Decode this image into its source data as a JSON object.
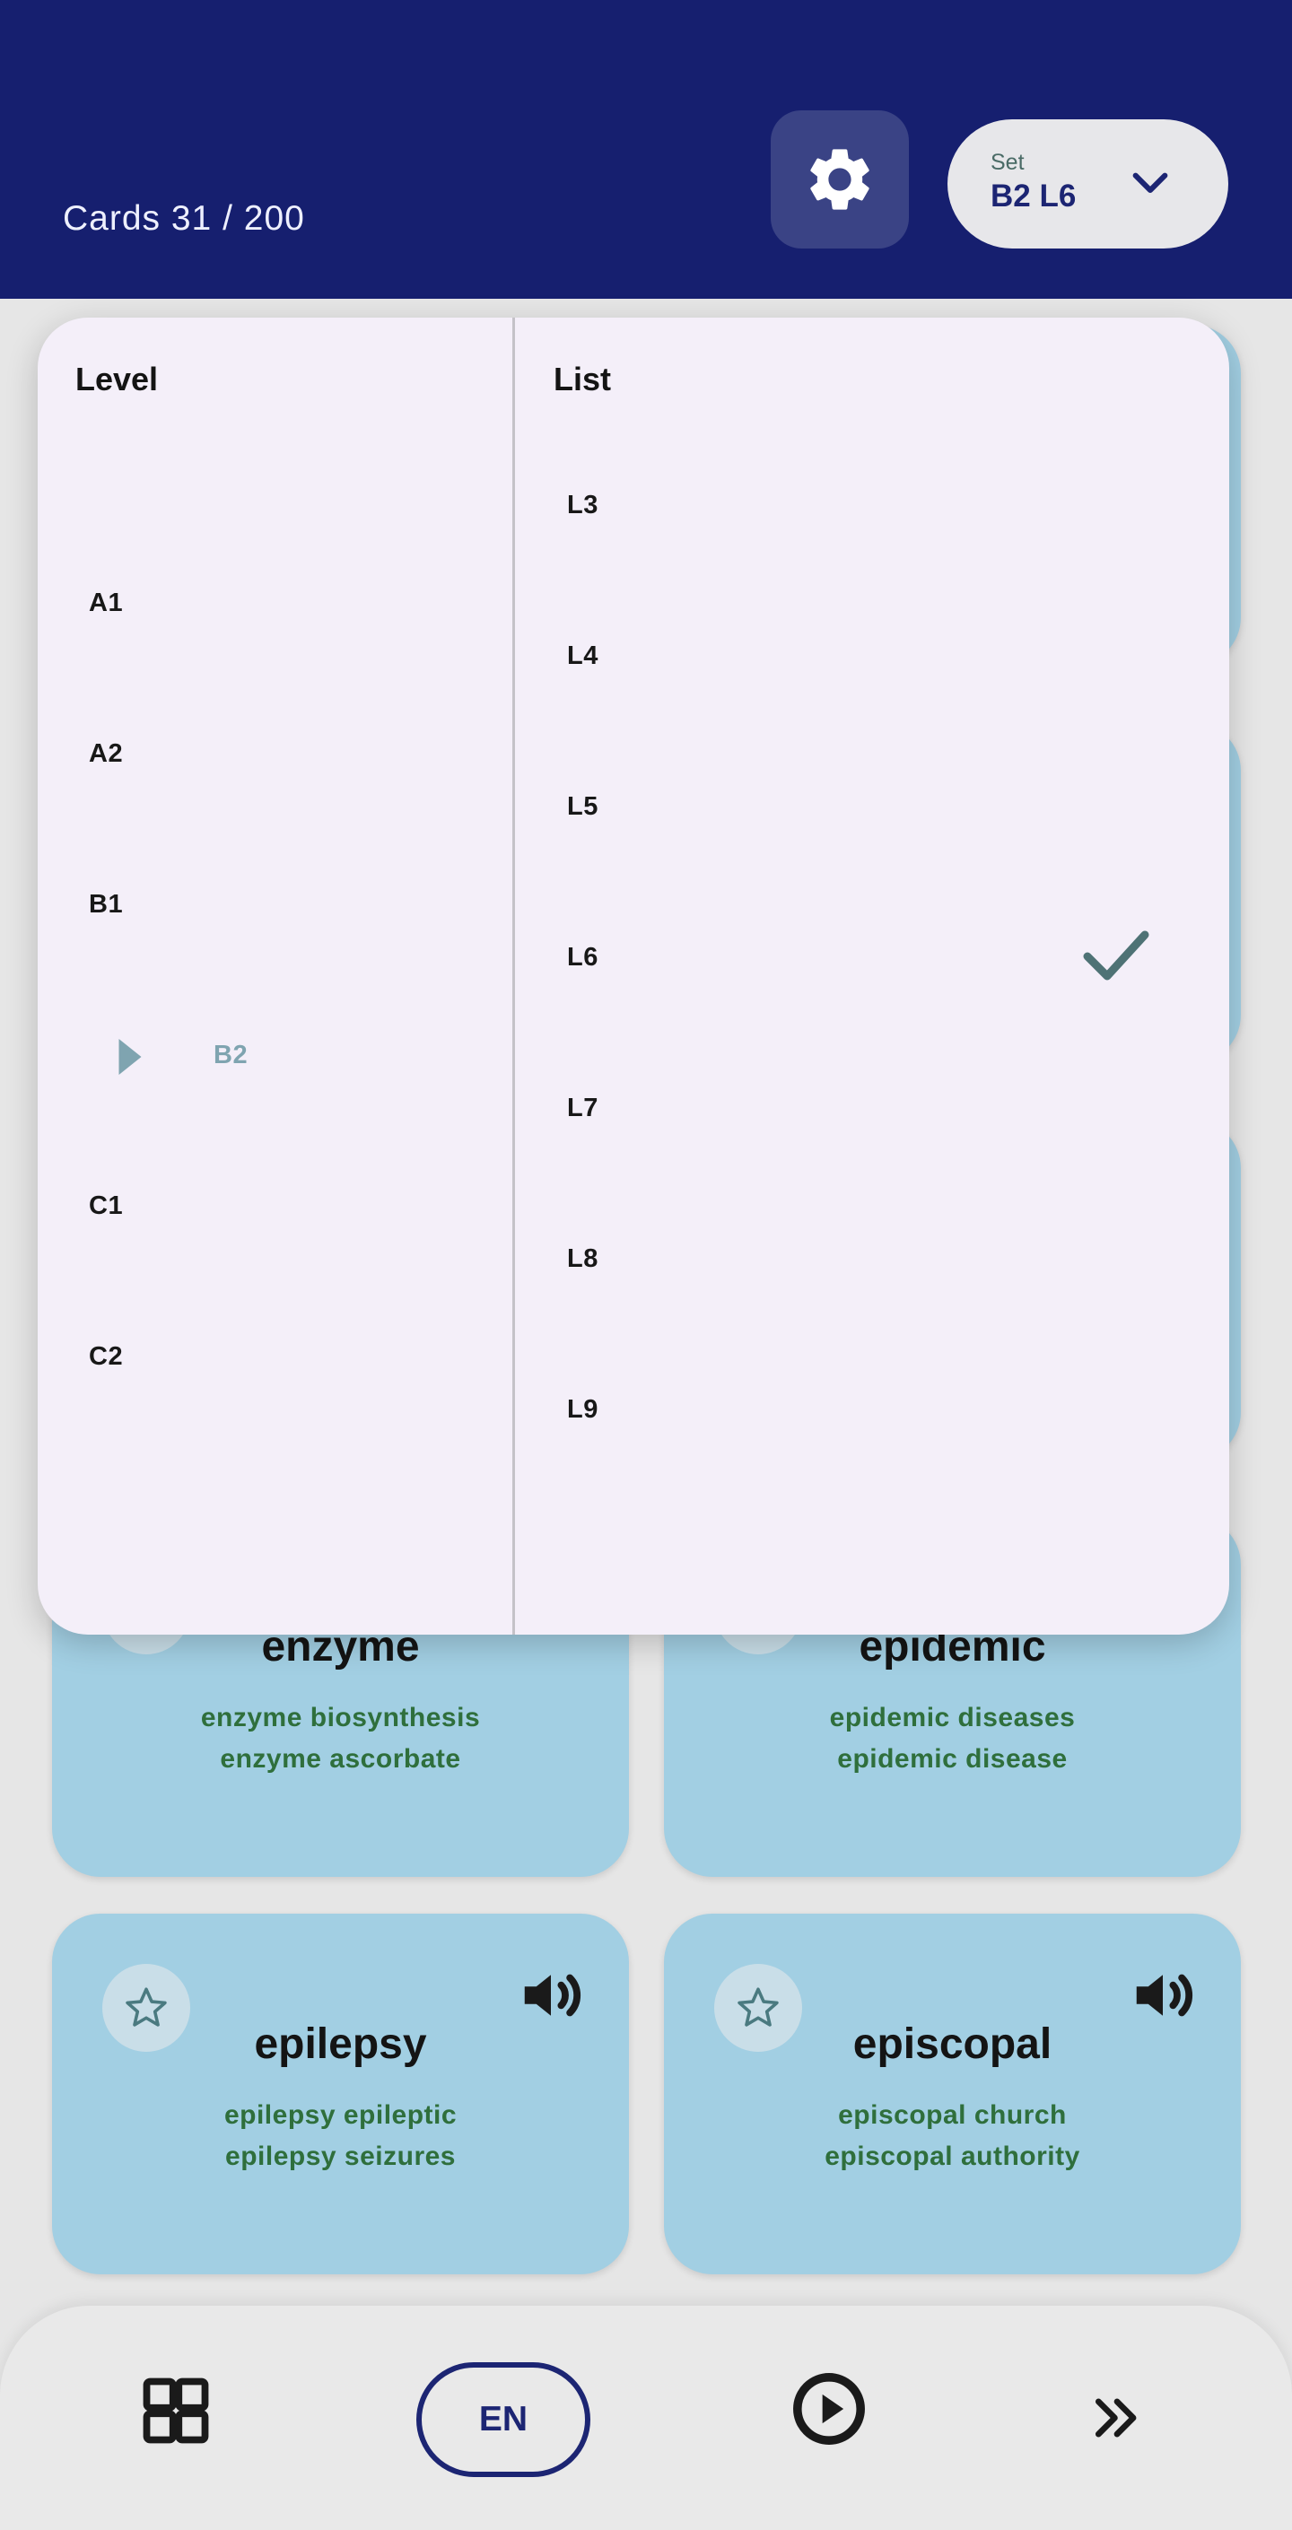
{
  "header": {
    "cards_count": "Cards 31 / 200",
    "settings_icon": "gear-icon",
    "set_label": "Set",
    "set_value": "B2 L6",
    "set_icon": "chevron-down-icon"
  },
  "cards": [
    {
      "word": "enzyme",
      "phrase1": "enzyme biosynthesis",
      "phrase2": "enzyme ascorbate"
    },
    {
      "word": "epidemic",
      "phrase1": "epidemic diseases",
      "phrase2": "epidemic disease"
    },
    {
      "word": "epilepsy",
      "phrase1": "epilepsy epileptic",
      "phrase2": "epilepsy seizures"
    },
    {
      "word": "episcopal",
      "phrase1": "episcopal church",
      "phrase2": "episcopal authority"
    }
  ],
  "dropdown": {
    "level_heading": "Level",
    "list_heading": "List",
    "levels": [
      "A1",
      "A2",
      "B1",
      "B2",
      "C1",
      "C2"
    ],
    "selected_level": "B2",
    "lists": [
      "L3",
      "L4",
      "L5",
      "L6",
      "L7",
      "L8",
      "L9"
    ],
    "selected_list": "L6"
  },
  "bottom_nav": {
    "grid_icon": "grid-icon",
    "language": "EN",
    "play_icon": "play-circle-icon",
    "next_icon": "double-chevron-right-icon"
  },
  "colors": {
    "header_bg": "#161f6f",
    "card_bg": "#a2cfe3",
    "panel_bg": "#f4eff9",
    "phrase_text": "#2f6f3c",
    "accent_navy": "#1c2573"
  }
}
